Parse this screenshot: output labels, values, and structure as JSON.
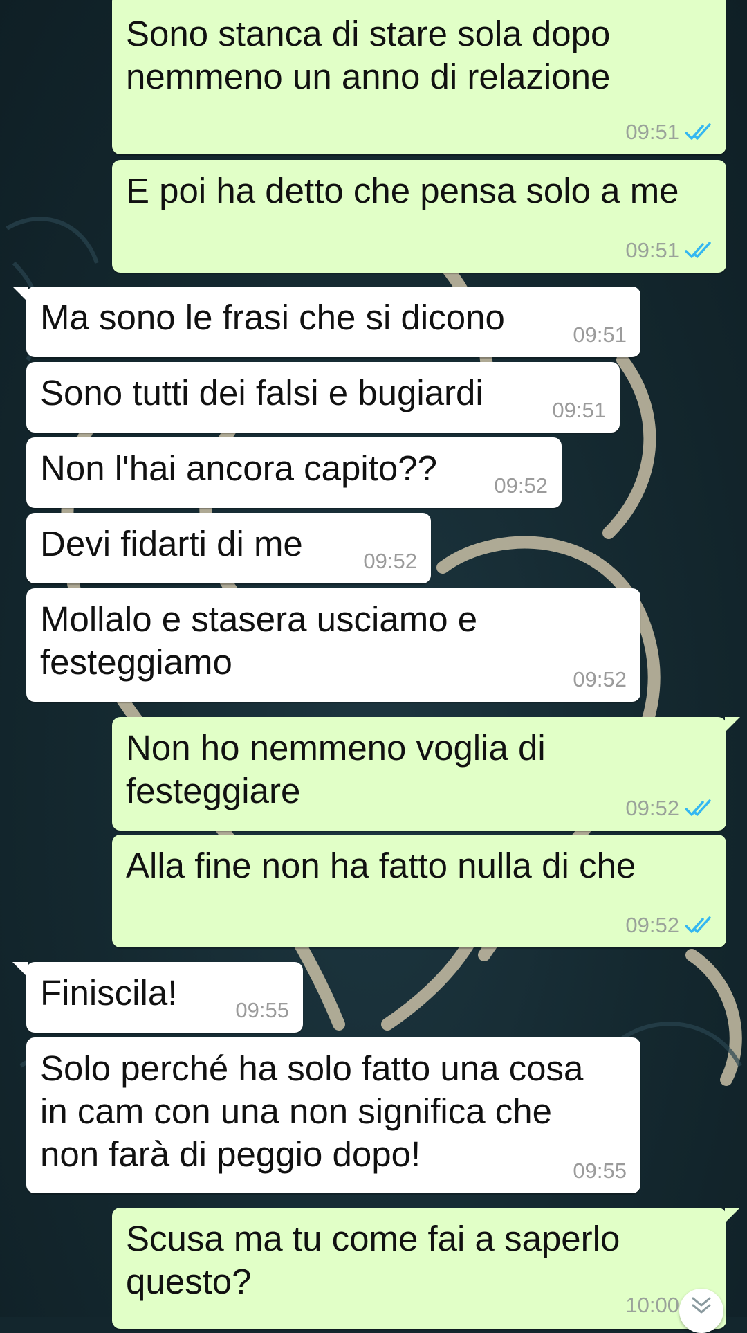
{
  "theme": {
    "incoming_bg": "#ffffff",
    "outgoing_bg": "#e1ffc7",
    "read_check_color": "#34b7f1",
    "wallpaper": "#14282f"
  },
  "messages": [
    {
      "direction": "outgoing",
      "text": "Sono stanca di stare sola dopo\nnemmeno un anno di relazione",
      "time": "09:51",
      "status": "read"
    },
    {
      "direction": "outgoing",
      "text": "E poi ha detto che pensa solo a me",
      "time": "09:51",
      "status": "read"
    },
    {
      "direction": "incoming",
      "text": "Ma sono le frasi che si dicono",
      "time": "09:51"
    },
    {
      "direction": "incoming",
      "text": "Sono tutti dei falsi e bugiardi",
      "time": "09:51"
    },
    {
      "direction": "incoming",
      "text": "Non l'hai ancora capito??",
      "time": "09:52"
    },
    {
      "direction": "incoming",
      "text": "Devi fidarti di me",
      "time": "09:52"
    },
    {
      "direction": "incoming",
      "text": "Mollalo e stasera usciamo e\nfesteggiamo",
      "time": "09:52"
    },
    {
      "direction": "outgoing",
      "text": "Non ho nemmeno voglia di\nfesteggiare",
      "time": "09:52",
      "status": "read"
    },
    {
      "direction": "outgoing",
      "text": "Alla fine non ha fatto nulla di che",
      "time": "09:52",
      "status": "read"
    },
    {
      "direction": "incoming",
      "text": "Finiscila!",
      "time": "09:55"
    },
    {
      "direction": "incoming",
      "text": "Solo perché ha solo fatto una cosa\nin cam con una non significa che\nnon farà di peggio dopo!",
      "time": "09:55"
    },
    {
      "direction": "outgoing",
      "text": "Scusa ma tu come fai a saperlo\nquesto?",
      "time": "10:00",
      "status": "read"
    }
  ],
  "scroll_down_icon": "chevron-double-down-icon"
}
